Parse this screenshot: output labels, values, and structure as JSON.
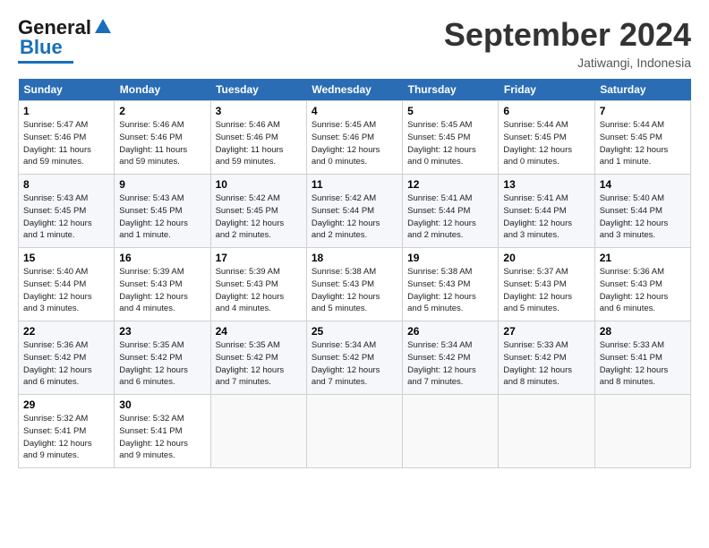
{
  "header": {
    "logo_line1": "General",
    "logo_line2": "Blue",
    "month": "September 2024",
    "location": "Jatiwangi, Indonesia"
  },
  "days_of_week": [
    "Sunday",
    "Monday",
    "Tuesday",
    "Wednesday",
    "Thursday",
    "Friday",
    "Saturday"
  ],
  "weeks": [
    [
      {
        "day": "1",
        "info": "Sunrise: 5:47 AM\nSunset: 5:46 PM\nDaylight: 11 hours\nand 59 minutes."
      },
      {
        "day": "2",
        "info": "Sunrise: 5:46 AM\nSunset: 5:46 PM\nDaylight: 11 hours\nand 59 minutes."
      },
      {
        "day": "3",
        "info": "Sunrise: 5:46 AM\nSunset: 5:46 PM\nDaylight: 11 hours\nand 59 minutes."
      },
      {
        "day": "4",
        "info": "Sunrise: 5:45 AM\nSunset: 5:46 PM\nDaylight: 12 hours\nand 0 minutes."
      },
      {
        "day": "5",
        "info": "Sunrise: 5:45 AM\nSunset: 5:45 PM\nDaylight: 12 hours\nand 0 minutes."
      },
      {
        "day": "6",
        "info": "Sunrise: 5:44 AM\nSunset: 5:45 PM\nDaylight: 12 hours\nand 0 minutes."
      },
      {
        "day": "7",
        "info": "Sunrise: 5:44 AM\nSunset: 5:45 PM\nDaylight: 12 hours\nand 1 minute."
      }
    ],
    [
      {
        "day": "8",
        "info": "Sunrise: 5:43 AM\nSunset: 5:45 PM\nDaylight: 12 hours\nand 1 minute."
      },
      {
        "day": "9",
        "info": "Sunrise: 5:43 AM\nSunset: 5:45 PM\nDaylight: 12 hours\nand 1 minute."
      },
      {
        "day": "10",
        "info": "Sunrise: 5:42 AM\nSunset: 5:45 PM\nDaylight: 12 hours\nand 2 minutes."
      },
      {
        "day": "11",
        "info": "Sunrise: 5:42 AM\nSunset: 5:44 PM\nDaylight: 12 hours\nand 2 minutes."
      },
      {
        "day": "12",
        "info": "Sunrise: 5:41 AM\nSunset: 5:44 PM\nDaylight: 12 hours\nand 2 minutes."
      },
      {
        "day": "13",
        "info": "Sunrise: 5:41 AM\nSunset: 5:44 PM\nDaylight: 12 hours\nand 3 minutes."
      },
      {
        "day": "14",
        "info": "Sunrise: 5:40 AM\nSunset: 5:44 PM\nDaylight: 12 hours\nand 3 minutes."
      }
    ],
    [
      {
        "day": "15",
        "info": "Sunrise: 5:40 AM\nSunset: 5:44 PM\nDaylight: 12 hours\nand 3 minutes."
      },
      {
        "day": "16",
        "info": "Sunrise: 5:39 AM\nSunset: 5:43 PM\nDaylight: 12 hours\nand 4 minutes."
      },
      {
        "day": "17",
        "info": "Sunrise: 5:39 AM\nSunset: 5:43 PM\nDaylight: 12 hours\nand 4 minutes."
      },
      {
        "day": "18",
        "info": "Sunrise: 5:38 AM\nSunset: 5:43 PM\nDaylight: 12 hours\nand 5 minutes."
      },
      {
        "day": "19",
        "info": "Sunrise: 5:38 AM\nSunset: 5:43 PM\nDaylight: 12 hours\nand 5 minutes."
      },
      {
        "day": "20",
        "info": "Sunrise: 5:37 AM\nSunset: 5:43 PM\nDaylight: 12 hours\nand 5 minutes."
      },
      {
        "day": "21",
        "info": "Sunrise: 5:36 AM\nSunset: 5:43 PM\nDaylight: 12 hours\nand 6 minutes."
      }
    ],
    [
      {
        "day": "22",
        "info": "Sunrise: 5:36 AM\nSunset: 5:42 PM\nDaylight: 12 hours\nand 6 minutes."
      },
      {
        "day": "23",
        "info": "Sunrise: 5:35 AM\nSunset: 5:42 PM\nDaylight: 12 hours\nand 6 minutes."
      },
      {
        "day": "24",
        "info": "Sunrise: 5:35 AM\nSunset: 5:42 PM\nDaylight: 12 hours\nand 7 minutes."
      },
      {
        "day": "25",
        "info": "Sunrise: 5:34 AM\nSunset: 5:42 PM\nDaylight: 12 hours\nand 7 minutes."
      },
      {
        "day": "26",
        "info": "Sunrise: 5:34 AM\nSunset: 5:42 PM\nDaylight: 12 hours\nand 7 minutes."
      },
      {
        "day": "27",
        "info": "Sunrise: 5:33 AM\nSunset: 5:42 PM\nDaylight: 12 hours\nand 8 minutes."
      },
      {
        "day": "28",
        "info": "Sunrise: 5:33 AM\nSunset: 5:41 PM\nDaylight: 12 hours\nand 8 minutes."
      }
    ],
    [
      {
        "day": "29",
        "info": "Sunrise: 5:32 AM\nSunset: 5:41 PM\nDaylight: 12 hours\nand 9 minutes."
      },
      {
        "day": "30",
        "info": "Sunrise: 5:32 AM\nSunset: 5:41 PM\nDaylight: 12 hours\nand 9 minutes."
      },
      {
        "day": "",
        "info": ""
      },
      {
        "day": "",
        "info": ""
      },
      {
        "day": "",
        "info": ""
      },
      {
        "day": "",
        "info": ""
      },
      {
        "day": "",
        "info": ""
      }
    ]
  ]
}
